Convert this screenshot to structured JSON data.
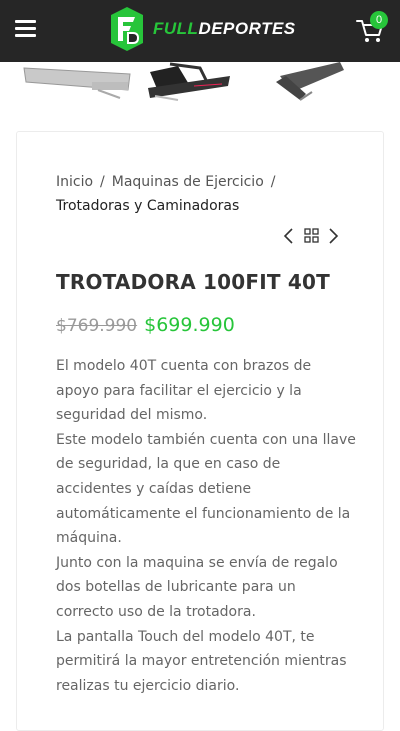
{
  "header": {
    "brand_prefix": "FULL",
    "brand_suffix": "DEPORTES",
    "cart_count": "0",
    "accent_color": "#27c53a",
    "background_color": "#262626"
  },
  "breadcrumb": {
    "items": [
      "Inicio",
      "Maquinas de Ejercicio"
    ],
    "separator": "/",
    "current": "Trotadoras y Caminadoras"
  },
  "product": {
    "title": "TROTADORA 100FIT 40T",
    "old_price": "$769.990",
    "price": "$699.990",
    "description": [
      "El modelo 40T cuenta con brazos de apoyo para facilitar el ejercicio y la seguridad del mismo.",
      "Este modelo también cuenta con una llave de seguridad, la que en caso de accidentes y caídas detiene automáticamente el funcionamiento de la máquina.",
      "Junto con la maquina se envía de regalo dos botellas de lubricante para un correcto uso de la trotadora.",
      "La pantalla Touch del modelo 40T, te permitirá la mayor entretención mientras realizas tu ejercicio diario."
    ]
  },
  "icons": {
    "menu": "hamburger-menu-icon",
    "cart": "shopping-cart-icon",
    "prev": "chevron-left-icon",
    "grid": "grid-icon",
    "next": "chevron-right-icon"
  }
}
